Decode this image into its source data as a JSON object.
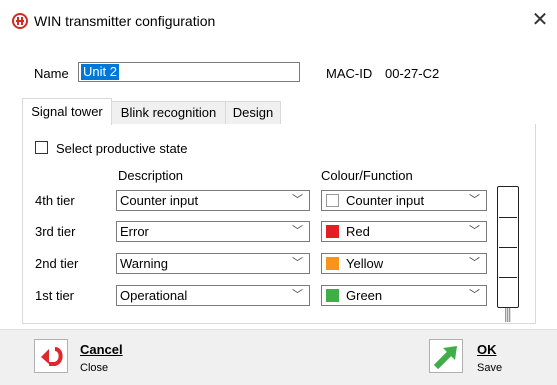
{
  "window": {
    "title": "WIN transmitter configuration",
    "logo": "logo-icon",
    "close_icon": "close-icon"
  },
  "header": {
    "name_label": "Name",
    "name_value": "Unit 2",
    "mac_label": "MAC-ID",
    "mac_value": "00-27-C2"
  },
  "tabs": [
    {
      "label": "Signal tower",
      "active": true
    },
    {
      "label": "Blink recognition",
      "active": false
    },
    {
      "label": "Design",
      "active": false
    }
  ],
  "signal_tower": {
    "productive_label": "Select productive state",
    "productive_checked": false,
    "col_description": "Description",
    "col_colour": "Colour/Function",
    "tiers": [
      {
        "label": "4th tier",
        "description": "Counter input",
        "colour": "Counter input",
        "swatch": "#ffffff"
      },
      {
        "label": "3rd tier",
        "description": "Error",
        "colour": "Red",
        "swatch": "#e31e24"
      },
      {
        "label": "2nd tier",
        "description": "Warning",
        "colour": "Yellow",
        "swatch": "#f7941d"
      },
      {
        "label": "1st tier",
        "description": "Operational",
        "colour": "Green",
        "swatch": "#3fae49"
      }
    ]
  },
  "footer": {
    "cancel_title": "Cancel",
    "cancel_sub": "Close",
    "cancel_icon": "undo-arrow-icon",
    "cancel_color": "#e0272f",
    "ok_title": "OK",
    "ok_sub": "Save",
    "ok_icon": "ok-arrow-icon",
    "ok_color": "#3fae49"
  }
}
